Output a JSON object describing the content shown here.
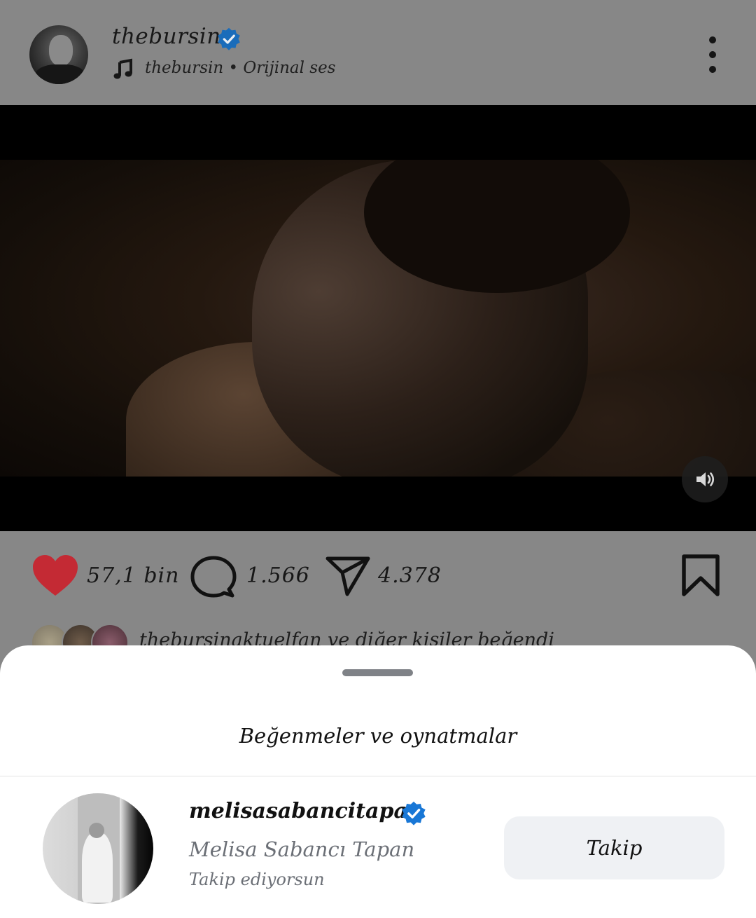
{
  "post": {
    "username": "thebursin",
    "audio_user": "thebursin",
    "audio_separator": "•",
    "audio_name": "Orijinal ses",
    "verified": true
  },
  "actions": {
    "likes": "57,1 bin",
    "comments": "1.566",
    "shares": "4.378",
    "heart_color": "#c42a34"
  },
  "liked_by": {
    "text": "thebursinaktuelfan ve diğer kişiler beğendi"
  },
  "sheet": {
    "title": "Beğenmeler ve oynatmalar",
    "users": [
      {
        "username": "melisasabancitapan",
        "full_name": "Melisa Sabancı Tapan",
        "status": "Takip ediyorsun",
        "follow_label": "Takip",
        "verified": true
      }
    ]
  },
  "colors": {
    "verified_blue": "#1877d6",
    "overlay": "#878787",
    "sheet_bg": "#ffffff",
    "button_bg": "#eff1f4",
    "secondary_text": "#6b6f76"
  },
  "icons": [
    "music-note-icon",
    "verified-badge-icon",
    "more-vertical-icon",
    "volume-icon",
    "heart-icon",
    "comment-icon",
    "share-icon",
    "bookmark-icon"
  ]
}
